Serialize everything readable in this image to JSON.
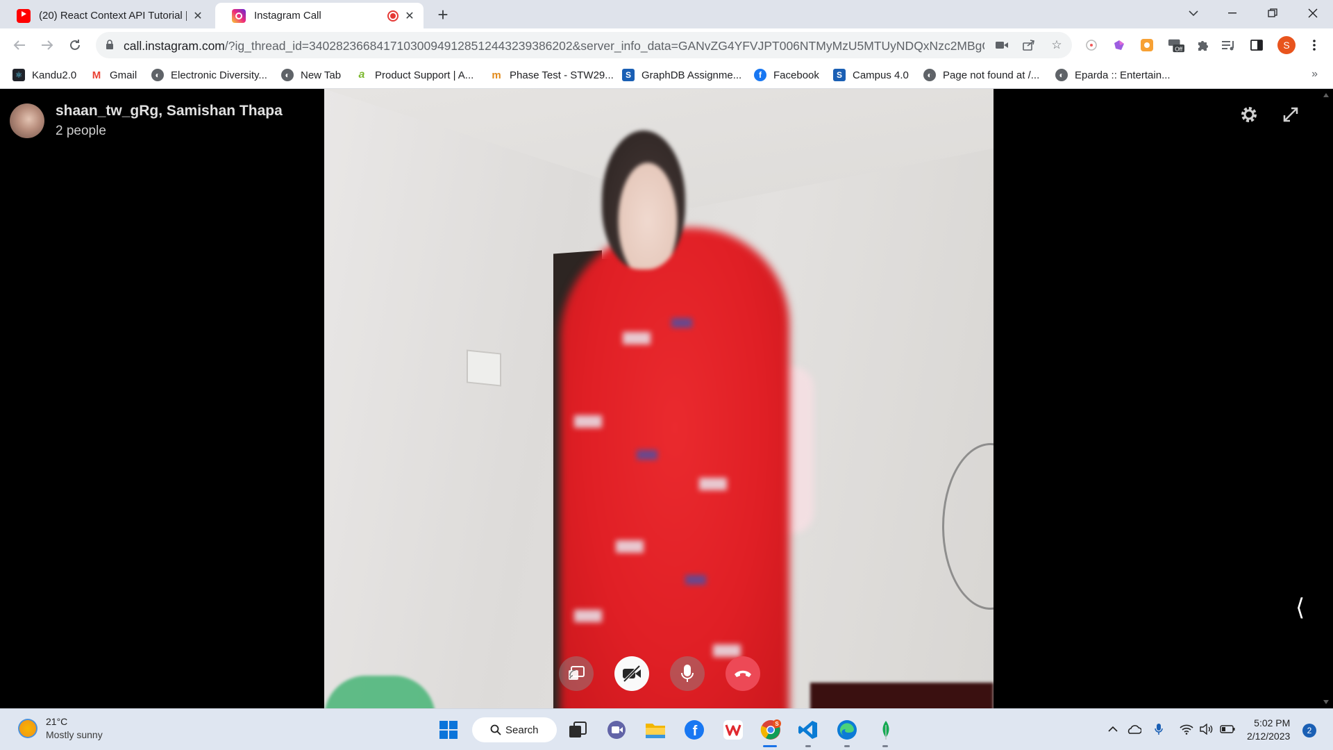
{
  "browser": {
    "tabs": [
      {
        "title": "(20) React Context API Tutorial | C",
        "icon": "youtube-icon",
        "active": false
      },
      {
        "title": "Instagram Call",
        "icon": "instagram-icon",
        "active": true
      }
    ],
    "url": {
      "host": "call.instagram.com",
      "path": "/?ig_thread_id=340282366841710300949128512443239386202&server_info_data=GANvZG4YFVJPT006NTMyMzU5MTUyNDQxNzc2MBgQS..."
    },
    "profile_initial": "S",
    "extension_badge": "Off",
    "bookmarks": [
      {
        "label": "Kandu2.0",
        "icon": "react-icon"
      },
      {
        "label": "Gmail",
        "icon": "gmail-icon"
      },
      {
        "label": "Electronic Diversity...",
        "icon": "globe-icon"
      },
      {
        "label": "New Tab",
        "icon": "globe-icon"
      },
      {
        "label": "Product Support | A...",
        "icon": "a-logo-icon"
      },
      {
        "label": "Phase Test - STW29...",
        "icon": "m-logo-icon"
      },
      {
        "label": "GraphDB Assignme...",
        "icon": "s-logo-icon"
      },
      {
        "label": "Facebook",
        "icon": "facebook-icon"
      },
      {
        "label": "Campus 4.0",
        "icon": "s-logo-icon"
      },
      {
        "label": "Page not found at /...",
        "icon": "globe-icon"
      },
      {
        "label": "Eparda :: Entertain...",
        "icon": "globe-icon"
      }
    ]
  },
  "call": {
    "participants_title": "shaan_tw_gRg, Samishan Thapa",
    "participants_count": "2 people"
  },
  "taskbar": {
    "weather": {
      "temp": "21°C",
      "condition": "Mostly sunny"
    },
    "search_label": "Search",
    "clock": {
      "time": "5:02 PM",
      "date": "2/12/2023"
    },
    "notification_count": "2"
  },
  "colors": {
    "end_call": "#ed4956",
    "tab_strip": "#dfe3eb",
    "taskbar": "#dfe6f1",
    "profile": "#e8541d"
  }
}
